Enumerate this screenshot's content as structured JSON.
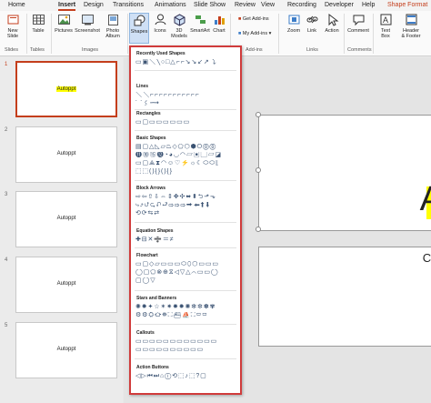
{
  "tabs": [
    "Home",
    "Insert",
    "Design",
    "Transitions",
    "Animations",
    "Slide Show",
    "Review",
    "View",
    "Recording",
    "Developer",
    "Help",
    "Shape Format"
  ],
  "ribbon": {
    "new_slide": "New\nSlide",
    "table": "Table",
    "pictures": "Pictures",
    "screenshot": "Screenshot",
    "photo_album": "Photo\nAlbum",
    "shapes": "Shapes",
    "icons": "Icons",
    "models_3d": "3D\nModels",
    "smartart": "SmartArt",
    "chart": "Chart",
    "get_addins": "Get Add-ins",
    "my_addins": "My Add-ins",
    "zoom": "Zoom",
    "link": "Link",
    "action": "Action",
    "comment": "Comment",
    "text_box": "Text\nBox",
    "header_footer": "Header\n& Footer",
    "groups": {
      "slides": "Slides",
      "tables": "Tables",
      "images": "Images",
      "addins": "Add-ins",
      "links": "Links",
      "comments": "Comments"
    }
  },
  "slides": [
    {
      "num": "1",
      "label": "Autoppt",
      "selected": true
    },
    {
      "num": "2",
      "label": "Autoppt",
      "selected": false
    },
    {
      "num": "3",
      "label": "Autoppt",
      "selected": false
    },
    {
      "num": "4",
      "label": "Autoppt",
      "selected": false
    },
    {
      "num": "5",
      "label": "Autoppt",
      "selected": false
    }
  ],
  "canvas": {
    "title_partial": "A",
    "subtitle_partial": "Cl"
  },
  "gallery": {
    "categories": {
      "recent": "Recently Used Shapes",
      "lines": "Lines",
      "rectangles": "Rectangles",
      "basic": "Basic Shapes",
      "arrows": "Block Arrows",
      "equation": "Equation Shapes",
      "flowchart": "Flowchart",
      "stars": "Stars and Banners",
      "callouts": "Callouts",
      "actions": "Action Buttons"
    },
    "rows": {
      "recent": "▭▣＼╲○□△⌐⌐↘↘↙↗⤵",
      "lines1": "＼╲⌐⌐⌐⌐⌐⌐⌐⌐⌐⌐⌐",
      "lines2": "⌒⌇⟿",
      "rect": "▭▢▭▭▭▭▭▭",
      "basic1": "▤▢△◺▱⏢◇⬠⬡⬢⭘⓪⓪",
      "basic2": "⓫⓾⑮⓬◔◕◡◠▱▣▢▱◪",
      "basic3": "▭▢⟁⧗◠☺♡⚡☼☾⬭⬭⟦",
      "basic4": "⬚⬚(){}(){}",
      "arrows1": "⇨⇦⇧⇩⇔⇕✥✣⬌⬍⮌⬏⬎",
      "arrows2": "⤷⤴⮍⮎⮏⮐⇨⇨⇨⮕⬅⬆⬇",
      "arrows3": "⟲⟳⇆⇄",
      "equation": "✚⊟✕➗＝≠",
      "flow1": "▭▢◇▱▭▭▭⬭⬯⬡▭▭▭",
      "flow2": "◯▢⬠⊗⊕⧖◁▽△⌒▭▭◯",
      "flow3": "▢◯▽",
      "stars1": "✺✹✦☆✶✷✸✹✺✻✼✽✾",
      "stars2": "⚙⚙⛭⛮⛯⛶⛴⛵⛶▭▭",
      "callouts1": "▭▭▭▭▭▭▭▭▭▭▭▭",
      "callouts2": "▭▭▭▭▭▭▭▭▭▭",
      "actions": "◁▷⏮⏭⌂ⓘ⟲⬚♪⬚?▢"
    }
  }
}
